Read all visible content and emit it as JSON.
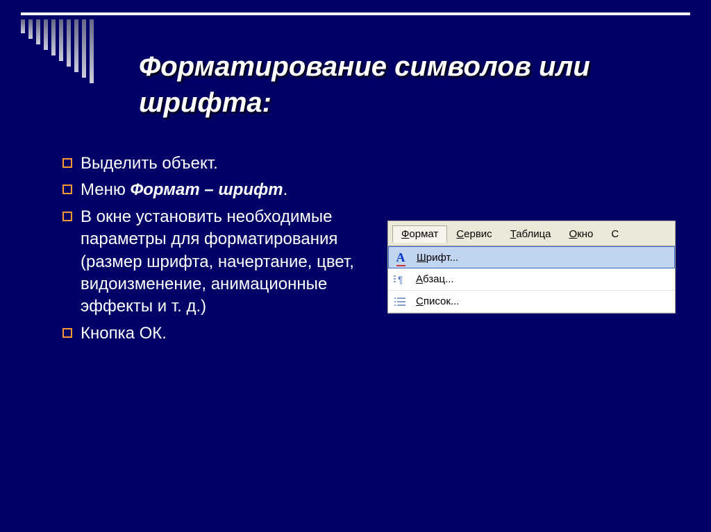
{
  "title": "Форматирование символов или шрифта:",
  "bullets": [
    {
      "text": "Выделить объект."
    },
    {
      "prefix": "Меню ",
      "emph": "Формат – шрифт",
      "suffix": "."
    },
    {
      "text": "В окне установить необходимые параметры для форматирования (размер шрифта, начертание, цвет, видоизменение, анимационные эффекты и т. д.)"
    },
    {
      "text": "Кнопка ОК."
    }
  ],
  "menu": {
    "bar": [
      "Формат",
      "Сервис",
      "Таблица",
      "Окно",
      "С"
    ],
    "items": [
      "Шрифт...",
      "Абзац...",
      "Список..."
    ]
  }
}
